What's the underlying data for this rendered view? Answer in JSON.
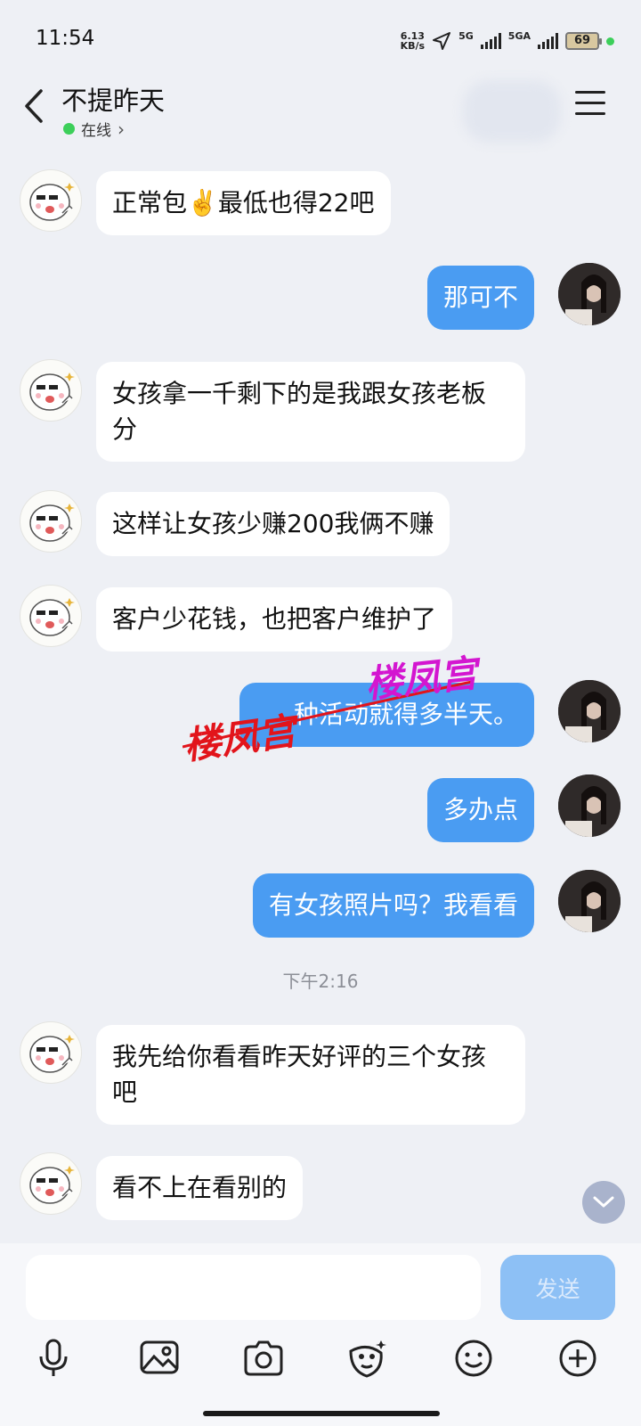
{
  "status_bar": {
    "time": "11:54",
    "net_speed_value": "6.13",
    "net_speed_unit": "KB/s",
    "signal1_label": "5G",
    "signal2_label": "5GA",
    "battery": "69"
  },
  "header": {
    "contact_name": "不提昨天",
    "status_text": "在线",
    "status_chevron": "›"
  },
  "messages": [
    {
      "side": "left",
      "text": "正常包✌️最低也得22吧"
    },
    {
      "side": "right",
      "text": "那可不"
    },
    {
      "side": "left",
      "text": "女孩拿一千剩下的是我跟女孩老板分"
    },
    {
      "side": "left",
      "text": "这样让女孩少赚200我俩不赚"
    },
    {
      "side": "left",
      "text": "客户少花钱，也把客户维护了"
    },
    {
      "side": "right",
      "text": "种活动就得多半天。"
    },
    {
      "side": "right",
      "text": "多办点"
    },
    {
      "side": "right",
      "text": "有女孩照片吗？我看看"
    },
    {
      "side": "left",
      "text": "我先给你看看昨天好评的三个女孩吧"
    },
    {
      "side": "left",
      "text": "看不上在看别的"
    }
  ],
  "timestamp": "下午2:16",
  "watermark": {
    "text_red": "楼凤宫",
    "text_magenta": "楼凤宫"
  },
  "input": {
    "placeholder": "",
    "send_label": "发送"
  },
  "toolbar_icons": [
    "microphone-icon",
    "image-icon",
    "camera-icon",
    "sticker-icon",
    "emoji-icon",
    "plus-icon"
  ],
  "colors": {
    "background": "#eef0f5",
    "bubble_right": "#4a9cf2",
    "bubble_left": "#ffffff",
    "send_button": "#8dc0f5",
    "online": "#3ccf5a"
  }
}
